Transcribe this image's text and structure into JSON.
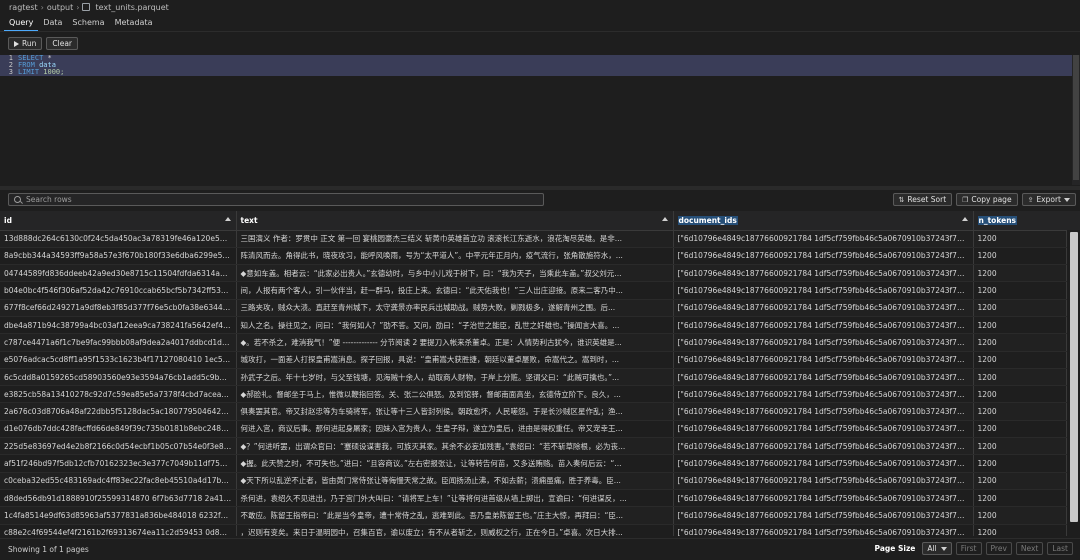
{
  "breadcrumb": [
    "ragtest",
    "output",
    "text_units.parquet"
  ],
  "tabs": [
    "Query",
    "Data",
    "Schema",
    "Metadata"
  ],
  "toolbar": {
    "run_label": "Run",
    "clear_label": "Clear"
  },
  "editor": {
    "lines": [
      {
        "num": "1",
        "kw": "SELECT",
        "rest": " *"
      },
      {
        "num": "2",
        "kw": "FROM",
        "rest": " data"
      },
      {
        "num": "3",
        "kw": "LIMIT",
        "rest": " 1000;"
      }
    ]
  },
  "search": {
    "placeholder": "Search rows"
  },
  "actions": {
    "reset_sort": "Reset Sort",
    "copy_page": "Copy page",
    "export": "Export"
  },
  "table": {
    "columns": [
      "id",
      "text",
      "document_ids",
      "n_tokens"
    ],
    "rows": [
      [
        "13d888dc264c6130c0f24c5da450ac3a78319fe46a120e5614...",
        "三国演义 作者：罗贯中 正文 第一回 宴桃园豪杰三结义 斩黄巾英雄首立功 滚滚长江东逝水，浪花淘尽英雄。是非...",
        "[\"6d10796e4849c18776600921784 1df5cf759fbb46c5a0670910b37243f7270a...",
        "1200"
      ],
      [
        "8a9cbb344a34593ff9a58a57e3f670b180f33e6dba6299e59e...",
        "阵清风而去。角得此书，晓夜攻习，能呼风唤雨，号为“太平道人”。中平元年正月内，疫气流行，张角散施符水，...",
        "[\"6d10796e4849c18776600921784 1df5cf759fbb46c5a0670910b37243f7270a...",
        "1200"
      ],
      [
        "04744589fd836ddeeb42a9ed30e8715c11504fdfda6314ae5e...",
        "◆意如车盖。相者云：“此家必出贵人。”玄德幼时，与乡中小儿戏于树下，曰：“我为天子，当乘此车盖。”叔父刘元...",
        "[\"6d10796e4849c18776600921784 1df5cf759fbb46c5a0670910b37243f7270a...",
        "1200"
      ],
      [
        "b04e0bc4f546f306af52da42c76910ccab65bcf5b7342ff53cd4...",
        "间，人报有两个客人，引一伙伴当，赶一群马，投庄上来。玄德曰：“此天佑我也！”三人出庄迎接。原来二客乃中...",
        "[\"6d10796e4849c18776600921784 1df5cf759fbb46c5a0670910b37243f7270a...",
        "1200"
      ],
      [
        "677f8cef66d249271a9df8eb3f85d377f76e5cb0fa38e6344bf5...",
        "三路夹攻，贼众大溃。直赶至青州城下，太守龚景亦率民兵出城助战。贼势大败，剿戮极多，遂解青州之围。后...",
        "[\"6d10796e4849c18776600921784 1df5cf759fbb46c5a0670910b37243f7270a...",
        "1200"
      ],
      [
        "dbe4a871b94c38799a4bc03af12eea9ca738241fa5642ef4f8e...",
        "知人之名。操往见之，问曰：“我何如人？”劭不答。又问，劭曰：“子治世之能臣，乱世之奸雄也。”操闻言大喜。...",
        "[\"6d10796e4849c18776600921784 1df5cf759fbb46c5a0670910b37243f7270a...",
        "1200"
      ],
      [
        "c787ce4471a6f1c7be9fac99bbb08af9dea2a4017ddbcd1d48...",
        "◆。若不杀之，难消我气！”便 ------------- 分节阅读 2 要提刀入帐来杀董卓。正是：人情势利古犹今，谁识英雄是...",
        "[\"6d10796e4849c18776600921784 1df5cf759fbb46c5a0670910b37243f7270a...",
        "1200"
      ],
      [
        "e5076adcac5cd8ff1a95f1533c1623b4f17127080410 1ec5644...",
        "城攻打，一面差人打探皇甫嵩消息。探子回报，具说：“皇甫嵩大获胜捷，朝廷以董卓屡败，命嵩代之。嵩到时，...",
        "[\"6d10796e4849c18776600921784 1df5cf759fbb46c5a0670910b37243f7270a...",
        "1200"
      ],
      [
        "6c5cdd8a0159265cd58903560e93e3594a76cb1add5c9b2bf...",
        "孙武子之后。年十七岁时，与父至钱塘，见海贼十余人，劫取商人财物，于岸上分赃。坚谓父曰：“此贼可擒也。”...",
        "[\"6d10796e4849c18776600921784 1df5cf759fbb46c5a0670910b37243f7270a...",
        "1200"
      ],
      [
        "e3825cb58a13410278c92d7c59ea85e5a7378f4cbd7acea612...",
        "◆郝脸礼。督邮坐于马上，惟微以鞭指回答。关、张二公俱怒。及到馆驿，督邮南面高坐，玄德侍立阶下。良久，...",
        "[\"6d10796e4849c18776600921784 1df5cf759fbb46c5a0670910b37243f7270a...",
        "1200"
      ],
      [
        "2a676c03d8706a48af22dbb5f5128dac5ac180779504642e9e...",
        "俱奏罢其官。帝又封赵忠等为车骑将军，张让等十三人皆封列侯。朝政愈坏，人民嗟怨。于是长沙贼区星作乱；渔...",
        "[\"6d10796e4849c18776600921784 1df5cf759fbb46c5a0670910b37243f7270a...",
        "1200"
      ],
      [
        "d1e076db7ddc428facffd66de849f39c735b0181b8ebc24810...",
        "何进入宫，商议后事。那何进起身屠家；因妹入宫为贵人，生皇子辩，遂立为皇后，进由是得权重任。帝又宠幸王...",
        "[\"6d10796e4849c18776600921784 1df5cf759fbb46c5a0670910b37243f7270a...",
        "1200"
      ],
      [
        "225d5e83697ed4e2b8f2166c0d54ecbf1b05c07b54e0f3e888...",
        "◆？”何进听罢，出谓众官曰：“蹇硕设谋害我，可族灭其家。其余不必妄加残害。”袁绍曰：“若不斩草除根，必为丧...",
        "[\"6d10796e4849c18776600921784 1df5cf759fbb46c5a0670910b37243f7270a...",
        "1200"
      ],
      [
        "af51f246bd97f5db12cfb70162323ec3e377c7049b11df75b8a...",
        "◆握。此天赞之时，不可失也。”进曰：“且容商议。”左右密报张让，让等转告何苗，又多送贿赂。苗入奏何后云：“...",
        "[\"6d10796e4849c18776600921784 1df5cf759fbb46c5a0670910b37243f7270a...",
        "1200"
      ],
      [
        "c0ceba32ed55c483169adc4ff83ec22fac8eb45510a4d17b85e...",
        "◆天下所以乱逆不止者，皆由黄门常侍张让等侮慢天常之故。臣闻扬汤止沸，不如去薪；溃痈虽痛，胜于养毒。臣...",
        "[\"6d10796e4849c18776600921784 1df5cf759fbb46c5a0670910b37243f7270a...",
        "1200"
      ],
      [
        "d8ded56db91d1888910f25599314870 6f7b63d7718 2a41d5c...",
        "杀何进，袁绍久不见进出，乃于宫门外大叫曰：“请将军上车！”让等将何进首级从墙上掷出，宣谕曰：“何进谋反，...",
        "[\"6d10796e4849c18776600921784 1df5cf759fbb46c5a0670910b37243f7270a...",
        "1200"
      ],
      [
        "1c4fa8514e9df63d85963af5377831a836be484018 6232f3a0...",
        "不敢应。陈留王指帝曰：“此是当今皇帝，遭十常侍之乱，逃难到此。吾乃皇弟陈留王也。”庄主大惊，再拜曰：“臣...",
        "[\"6d10796e4849c18776600921784 1df5cf759fbb46c5a0670910b37243f7270a...",
        "1200"
      ],
      [
        "c88e2c4f69544ef4f2161b2f69313674ea11c2d59453 0d894ca...",
        "，迟则有变矣。来日于温明园中，召集百官，谕以废立；有不从者斩之，则威权之行，正在今日。”卓喜。次日大排...",
        "[\"6d10796e4849c18776600921784 1df5cf759fbb46c5a0670910b37243f7270a...",
        "1200"
      ]
    ]
  },
  "footer": {
    "summary": "Showing 1 of 1 pages",
    "page_size_label": "Page Size",
    "page_size_value": "All",
    "first": "First",
    "prev": "Prev",
    "next": "Next",
    "last": "Last"
  }
}
